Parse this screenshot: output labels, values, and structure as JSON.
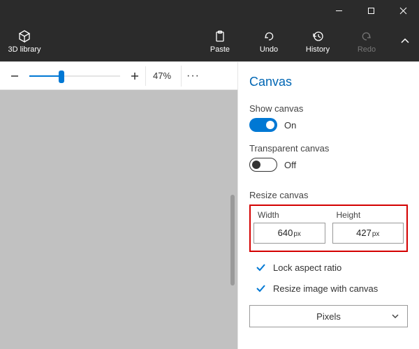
{
  "titlebar": {},
  "toolbar": {
    "library_label": "3D library",
    "paste_label": "Paste",
    "undo_label": "Undo",
    "history_label": "History",
    "redo_label": "Redo"
  },
  "zoom": {
    "value": "47%"
  },
  "panel": {
    "title": "Canvas",
    "show_canvas_label": "Show canvas",
    "show_canvas_state": "On",
    "transparent_label": "Transparent canvas",
    "transparent_state": "Off",
    "resize_label": "Resize canvas",
    "width_label": "Width",
    "height_label": "Height",
    "width_value": "640",
    "height_value": "427",
    "unit_abbr": "px",
    "lock_aspect_label": "Lock aspect ratio",
    "resize_image_label": "Resize image with canvas",
    "unit_select": "Pixels"
  }
}
